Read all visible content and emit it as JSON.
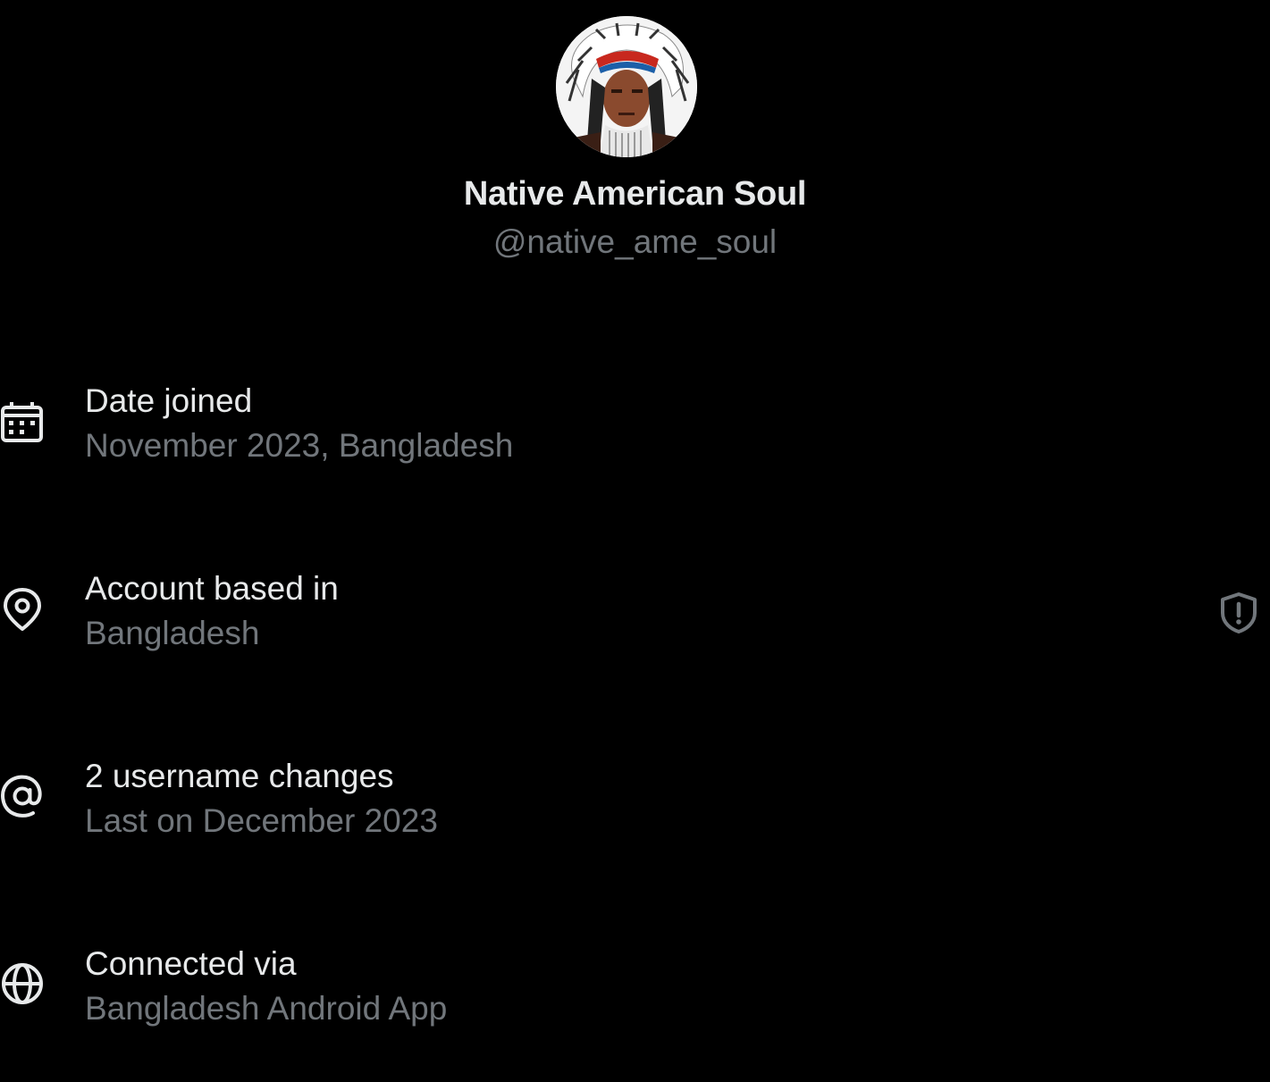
{
  "profile": {
    "display_name": "Native American Soul",
    "handle": "@native_ame_soul",
    "avatar_icon": "avatar-portrait"
  },
  "about": {
    "rows": [
      {
        "icon": "calendar-icon",
        "title": "Date joined",
        "value": "November 2023, Bangladesh"
      },
      {
        "icon": "location-pin-icon",
        "title": "Account based in",
        "value": "Bangladesh"
      },
      {
        "icon": "at-sign-icon",
        "title": "2 username changes",
        "value": "Last on December 2023"
      },
      {
        "icon": "globe-icon",
        "title": "Connected via",
        "value": "Bangladesh Android App"
      }
    ],
    "verify_icon": "shield-alert-icon"
  },
  "colors": {
    "background": "#000000",
    "primary_text": "#e7e9ea",
    "secondary_text": "#71767b"
  }
}
